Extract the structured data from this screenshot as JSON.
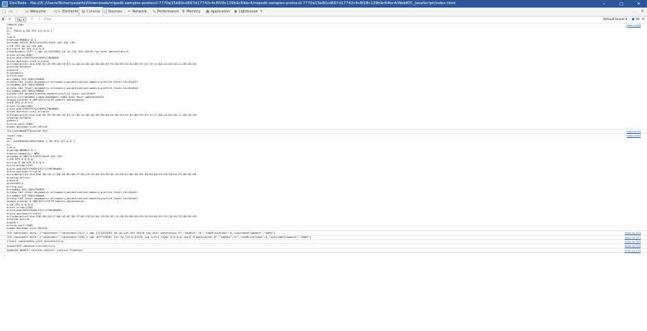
{
  "window": {
    "title": "DevTools - file:///C:/Users/Mcheriyadathil/Downloads/mipsdk-samples-protocol-7770a15b80cd667d17742c4c8f28c139b9c64bc4/mipsdk-samples-protocol-7770a15b80cd667d17742c4c8f28c139b9c64bc4/WebRTC_JavaScript/index.html"
  },
  "tabs": [
    {
      "label": "Welcome",
      "icon": "welcome-icon"
    },
    {
      "label": "Elements",
      "icon": "elements-icon"
    },
    {
      "label": "Console",
      "icon": "console-icon"
    },
    {
      "label": "Sources",
      "icon": "sources-icon"
    },
    {
      "label": "Network",
      "icon": "network-icon"
    },
    {
      "label": "Performance",
      "icon": "performance-icon"
    },
    {
      "label": "Memory",
      "icon": "memory-icon"
    },
    {
      "label": "Application",
      "icon": "application-icon"
    },
    {
      "label": "Lighthouse",
      "icon": "lighthouse-icon"
    }
  ],
  "active_tab": "Console",
  "console_toolbar": {
    "context": "top",
    "filter_placeholder": "Filter",
    "levels": "Default levels",
    "issues_count": "38"
  },
  "colors": {
    "titlebar": "#2b579a",
    "link": "#1558d6",
    "prompt": "#1a73e8"
  },
  "messages": [
    {
      "source": "main.ts:88",
      "lines": [
        "remote sdp:",
        "v=0",
        "o=- 79454 0 2N IP4 127.0.0.1",
        "s=-",
        "t=0 0",
        "a=group:BUNDLE 0 1",
        "m=video 49370 UDP/TLS/RTP/SAVP 101 102 103",
        "c=IN IP4 10.10.118.164",
        "a=rtcp:9 IN IP4 0.0.0.0",
        "a=candidate:2127 1 udp 2113937663 10.10.118.164 49370 typ host generation 0",
        "a=ice-ufrag:AUDX",
        "a=ice-pwd:VFNZY9VCXCQRPLC2MU8HNQ",
        "a=ice-options:ice2,trickle",
        "a=fingerprint:sha-256 B2:3F:03:00:C8:01:CC:4D:42:8E:AE:56:08:85:FD:6A:93:31:84:B6:FD:53:19:1C:88:23:03:50:C1:89:35:38",
        "a=setup:actpass",
        "a=mid:0",
        "a=sendonly",
        "a=rtcp-mux",
        "a=rtpmap:101 H264/90000",
        "a=fmtp:101 level-asymmetry-allowed=1;packetization-mode=1;profile-level-id=42e01f",
        "a=rtpmap:102 H264/90000",
        "a=fmtp:102 level-asymmetry-allowed=1;packetization-mode=1;profile-level-id=42e01d",
        "a=rtpmap:103 H264/90000",
        "a=fmtp:103 packetization-mode=0;profile-level-id=42e01f",
        "a=ssrc:1317262600 cname:a8268e6c-f388-4453-9bc5-c06e7645397a",
        "m=application 9 UDP/DTLS/SCTP webrtc-datachannel",
        "c=IN IP4 0.0.0.0",
        "a=ice-ufrag:AUDX",
        "a=ice-pwd:VFNZY9VCXCQRPLC2MU8HNQ",
        "a=ice-options:ice2,trickle",
        "a=fingerprint:sha-256 B2:3F:03:00:C8:01:CC:4D:42:8E:AE:56:08:85:FD:6A:93:31:84:B6:FD:53:19:1C:88:23:03:50:C1:89:35:38",
        "a=setup:actpass",
        "a=mid:1",
        "a=sctp-port:5000",
        "a=max-message-size:262144"
      ]
    },
    {
      "source": "main.ts:95",
      "lines": [
        "InitiateWebRTCSession end"
      ]
    },
    {
      "source": "main.ts:89",
      "lines": [
        "local sdp:",
        "v=0",
        "o=- 4470938582450276564 2 IN IP4 127.0.0.1",
        "s=-",
        "t=0 0",
        "a=group:BUNDLE 0 1",
        "a=msid-semantic: WMS",
        "m=video 9 UDP/TLS/RTP/SAVP 101 103",
        "c=IN IP4 0.0.0.0",
        "a=rtcp:9 IN IP4 0.0.0.0",
        "a=ice-ufrag:2242",
        "a=ice-pwd:NZ2G7kN2nI5Z/Jjt9B7Wq6Ri",
        "a=ice-options:trickle",
        "a=fingerprint:sha-256 88:CA:17:68:16:8C:3D:7F:62:F4:23:04:29:ED:3E:12:28:E2:86:38:99:39:94:60:93:C8:70:94:73:8D:DE:09",
        "a=setup:active",
        "a=mid:0",
        "a=recvonly",
        "a=rtcp-mux",
        "a=rtpmap:101 H264/90000",
        "a=fmtp:101 level-asymmetry-allowed=1;packetization-mode=1;profile-level-id=42e01f",
        "a=rtpmap:103 H264/90000",
        "a=fmtp:103 level-asymmetry-allowed=1;packetization-mode=0;profile-level-id=42e01f",
        "m=application 9 UDP/DTLS/SCTP webrtc-datachannel",
        "c=IN IP4 0.0.0.0",
        "a=ice-ufrag:2202",
        "a=ice-pwd:NZ2G7kN2nI5Z/Jjt9B7Wq6Ri",
        "a=ice-options:trickle",
        "a=fingerprint:sha-256 88:CA:17:68:16:8C:3D:7F:62:F4:23:04:29:ED:3E:12:28:E2:86:38:99:39:94:60:93:C8:70:94:73:8D:DE:09",
        "a=setup:active",
        "a=mid:1",
        "a=sctp-port:5000",
        "a=max-message-size:262144"
      ]
    },
    {
      "source": "main.ts:154",
      "lines": [
        "ICE candidate data: {\"candidate\":\"candidate:2127 1 udp 2113937663 10.10.118.164 49370 typ host generation 0\",\"sdpMid\":\"0\",\"sdpMLineIndex\":0,\"usernameFragment\":\"AUDX\"}"
      ]
    },
    {
      "source": "main.ts:154",
      "lines": [
        "ICE candidate data: {\"candidate\":\"candidate:1284 1 udp 1677729087 212.70.119.0 64120 typ srflx raddr 0.0.0.0 rport 0 generation 0\",\"sdpMid\":\"0\",\"sdpMLineIndex\":0,\"usernameFragment\":\"AUDX\"}"
      ]
    },
    {
      "source": "main.ts:163",
      "lines": [
        "Client candidates sent successfully"
      ]
    },
    {
      "source": "main.ts:125",
      "lines": [
        "AnswerSDP updated successfully"
      ]
    },
    {
      "source": "main.ts:129",
      "lines": [
        "Updated WebRTC session object: [object Promise]"
      ]
    }
  ],
  "prompt_symbol": "›"
}
